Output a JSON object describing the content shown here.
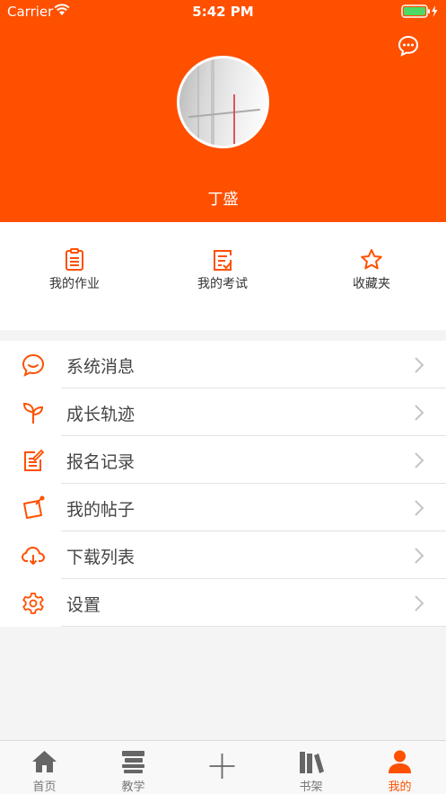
{
  "status_bar": {
    "carrier": "Carrier",
    "time": "5:42 PM"
  },
  "profile": {
    "username": "丁盛"
  },
  "quick_actions": [
    {
      "label": "我的作业",
      "icon": "clipboard-icon"
    },
    {
      "label": "我的考试",
      "icon": "exam-checklist-icon"
    },
    {
      "label": "收藏夹",
      "icon": "star-icon"
    }
  ],
  "menu": [
    {
      "label": "系统消息",
      "icon": "message-bubble-icon"
    },
    {
      "label": "成长轨迹",
      "icon": "sprout-icon"
    },
    {
      "label": "报名记录",
      "icon": "edit-note-icon"
    },
    {
      "label": "我的帖子",
      "icon": "post-pin-icon"
    },
    {
      "label": "下载列表",
      "icon": "cloud-download-icon"
    },
    {
      "label": "设置",
      "icon": "settings-gear-icon"
    }
  ],
  "tabbar": [
    {
      "label": "首页",
      "icon": "home-icon"
    },
    {
      "label": "教学",
      "icon": "teaching-stack-icon"
    },
    {
      "label": "",
      "icon": "plus-icon"
    },
    {
      "label": "书架",
      "icon": "bookshelf-icon"
    },
    {
      "label": "我的",
      "icon": "person-icon",
      "active": true
    }
  ],
  "colors": {
    "accent": "#ff5000",
    "text": "#444444",
    "tab_inactive": "#777777"
  }
}
